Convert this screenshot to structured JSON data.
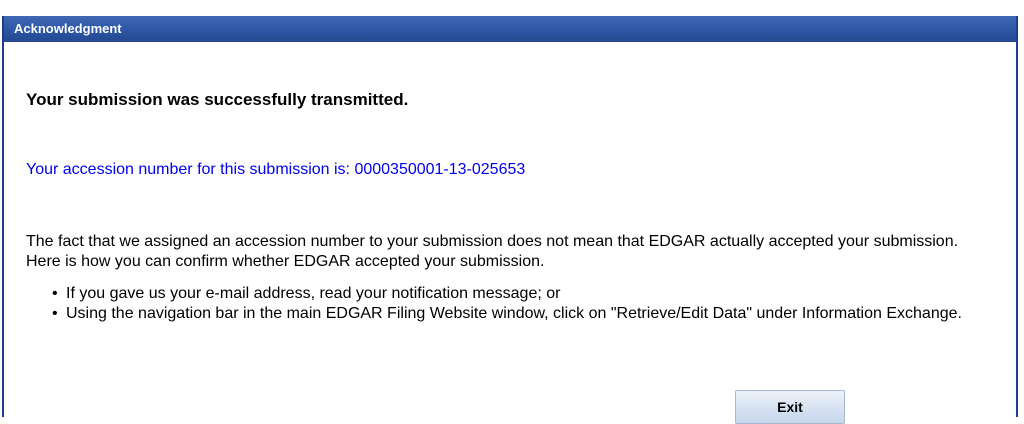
{
  "dialog": {
    "title": "Acknowledgment"
  },
  "message": {
    "success": "Your submission was successfully transmitted.",
    "accession": "Your accession number for this submission is: 0000350001-13-025653",
    "paragraph": "The fact that we assigned an accession number to your submission does not mean that EDGAR actually accepted your submission. Here is how you can confirm whether EDGAR accepted your submission.",
    "bullets": [
      "If you gave us your e-mail address, read your notification message; or",
      "Using the navigation bar in the main EDGAR Filing Website window, click on \"Retrieve/Edit Data\" under Information Exchange."
    ]
  },
  "actions": {
    "exit_label": "Exit"
  },
  "colors": {
    "title_bar": "#2c56a4",
    "accession_text": "#0000ee",
    "button_bg": "#d6e2f2"
  }
}
